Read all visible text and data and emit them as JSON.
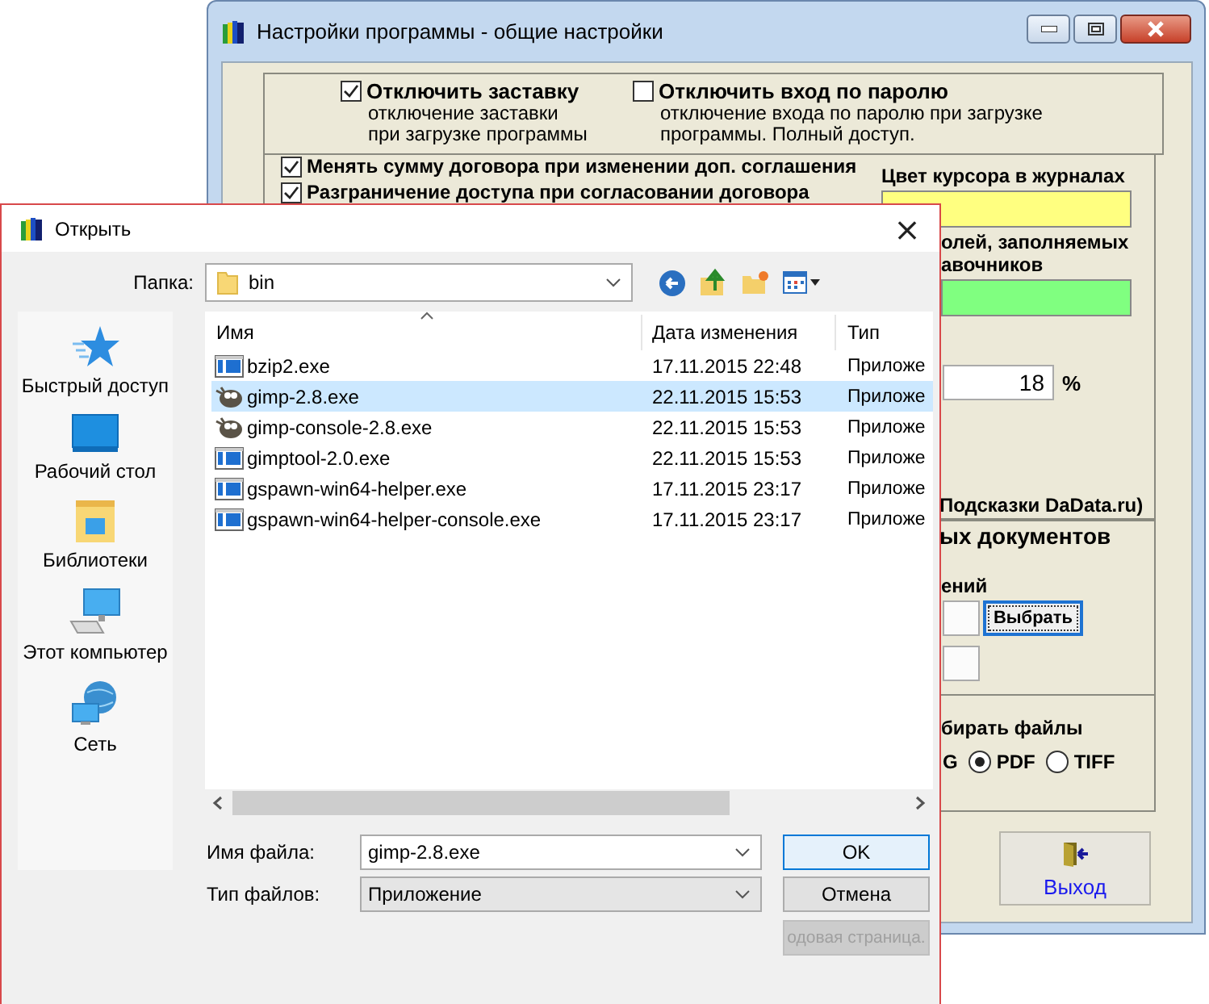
{
  "settings_window": {
    "title": "Настройки программы - общие настройки",
    "top_options": [
      {
        "label": "Отключить заставку",
        "description": [
          "отключение заставки",
          "при загрузке программы"
        ],
        "checked": true
      },
      {
        "label": "Отключить вход по паролю",
        "description": [
          "отключение входа по паролю при загрузке",
          "программы. Полный доступ."
        ],
        "checked": false
      }
    ],
    "options": [
      {
        "label": "Менять сумму договора при изменении доп. соглашения",
        "checked": true
      },
      {
        "label": "Разграничение доступа при согласовании договора",
        "checked": true
      }
    ],
    "color_fields": [
      {
        "label": [
          "Цвет курсора в журналах"
        ],
        "color": "#ffff80"
      },
      {
        "label": [
          "олей, заполняемых",
          "авочников"
        ],
        "color": "#80ff80"
      }
    ],
    "percent_field": {
      "value": "18",
      "unit": "%"
    },
    "dadata_label": "Подсказки DaData.ru)",
    "documents_heading": "ых документов",
    "storage_label": "ений",
    "choose_button": "Выбрать",
    "scan_label": "бирать файлы",
    "partial_format_label": "G",
    "formats": [
      {
        "label": "PDF",
        "selected": true
      },
      {
        "label": "TIFF",
        "selected": false
      }
    ],
    "exit_button": "Выход"
  },
  "open_dialog": {
    "title": "Открыть",
    "close": "×",
    "folder_label": "Папка:",
    "folder": "bin",
    "places": [
      {
        "label": "Быстрый доступ",
        "kind": "star"
      },
      {
        "label": "Рабочий стол",
        "kind": "desktop"
      },
      {
        "label": "Библиотеки",
        "kind": "libraries"
      },
      {
        "label": "Этот компьютер",
        "kind": "computer"
      },
      {
        "label": "Сеть",
        "kind": "network"
      }
    ],
    "columns": [
      "Имя",
      "Дата изменения",
      "Тип"
    ],
    "files": [
      {
        "name": "bzip2.exe",
        "date": "17.11.2015 22:48",
        "type": "Приложе",
        "kind": "exe",
        "selected": false
      },
      {
        "name": "gimp-2.8.exe",
        "date": "22.11.2015 15:53",
        "type": "Приложе",
        "kind": "gimp",
        "selected": true
      },
      {
        "name": "gimp-console-2.8.exe",
        "date": "22.11.2015 15:53",
        "type": "Приложе",
        "kind": "gimp",
        "selected": false
      },
      {
        "name": "gimptool-2.0.exe",
        "date": "22.11.2015 15:53",
        "type": "Приложе",
        "kind": "exe",
        "selected": false
      },
      {
        "name": "gspawn-win64-helper.exe",
        "date": "17.11.2015 23:17",
        "type": "Приложе",
        "kind": "exe",
        "selected": false
      },
      {
        "name": "gspawn-win64-helper-console.exe",
        "date": "17.11.2015 23:17",
        "type": "Приложе",
        "kind": "exe",
        "selected": false
      }
    ],
    "file_name_label": "Имя файла:",
    "file_name": "gimp-2.8.exe",
    "file_type_label": "Тип файлов:",
    "file_type": "Приложение",
    "buttons": [
      {
        "label": "OK",
        "kind": "default"
      },
      {
        "label": "Отмена",
        "kind": "normal"
      },
      {
        "label": "одовая страница.",
        "kind": "disabled"
      }
    ]
  }
}
